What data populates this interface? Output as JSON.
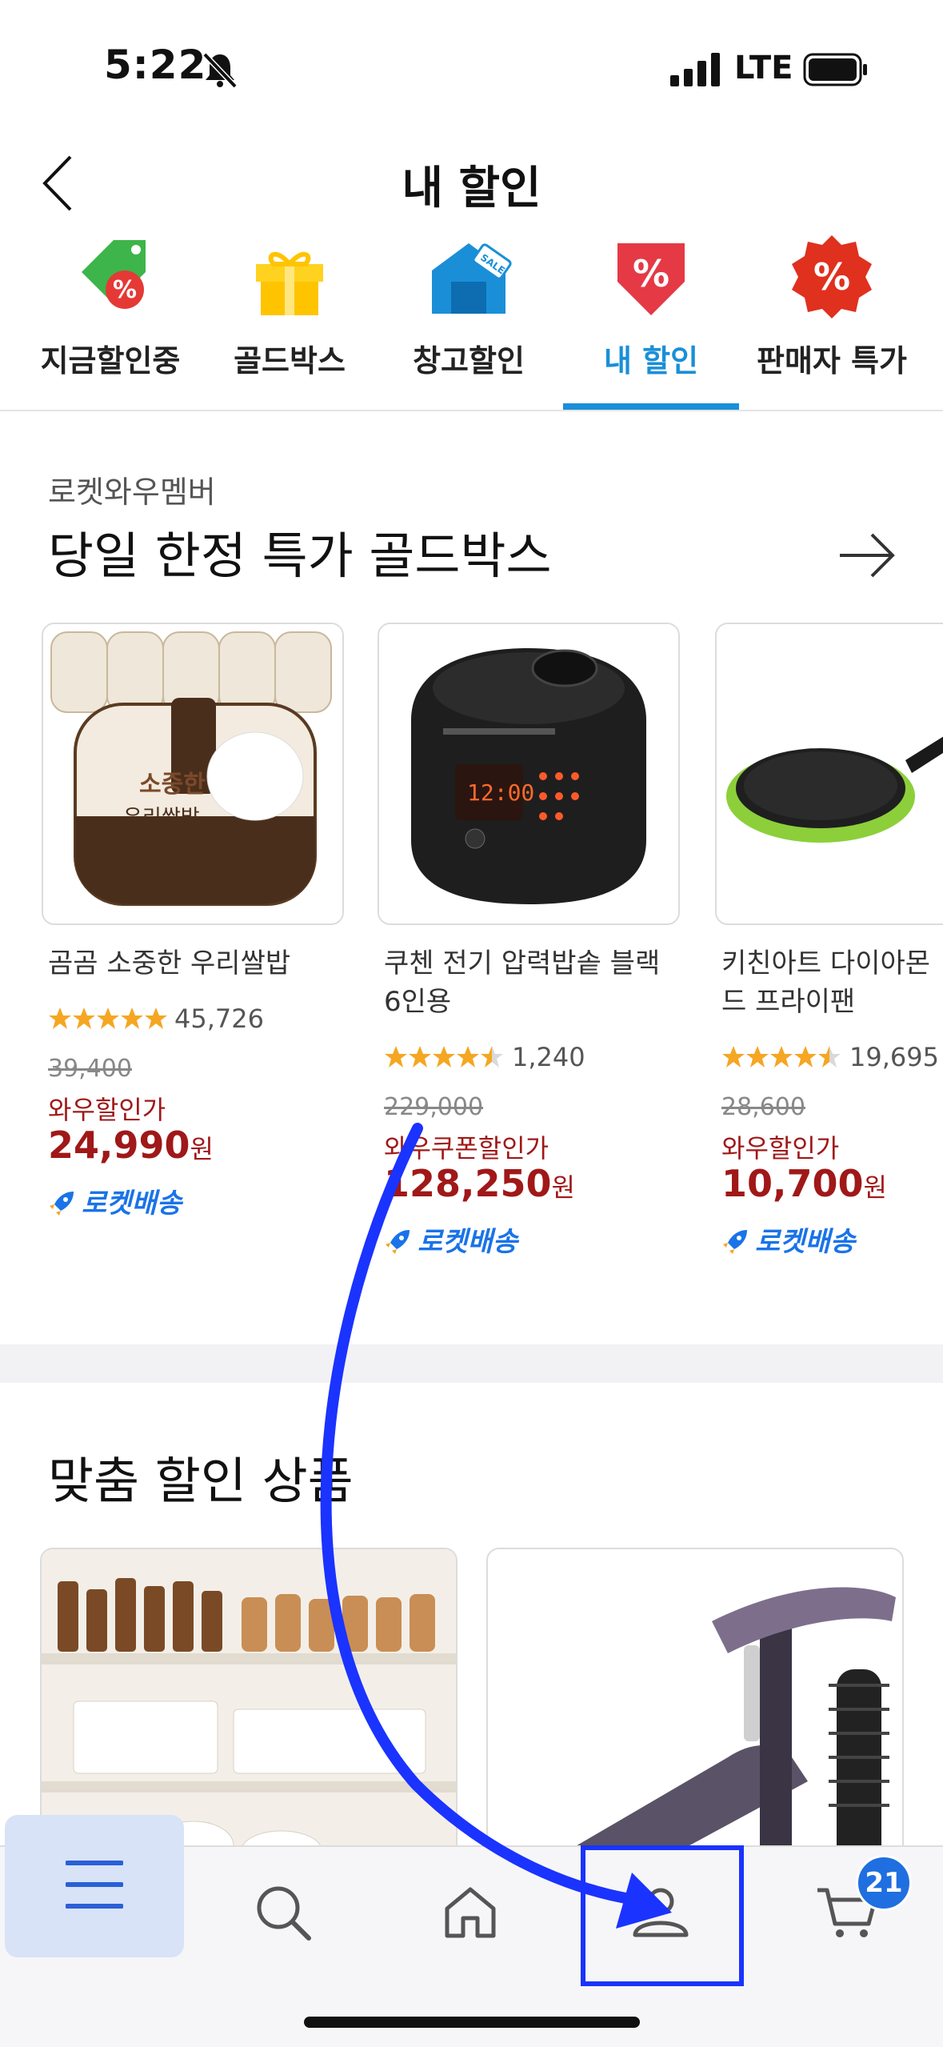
{
  "status_bar": {
    "time": "5:22",
    "network": "LTE"
  },
  "header": {
    "title": "내 할인"
  },
  "categories": [
    {
      "label": "지금할인중"
    },
    {
      "label": "골드박스"
    },
    {
      "label": "창고할인"
    },
    {
      "label": "내 할인",
      "active": true
    },
    {
      "label": "판매자 특가"
    }
  ],
  "gold_section": {
    "subtitle": "로켓와우멤버",
    "title": "당일 한정 특가 골드박스"
  },
  "products": [
    {
      "name": "곰곰 소중한 우리쌀밥",
      "rating": 5,
      "reviews": "45,726",
      "original_price": "39,400",
      "discount_label": "와우할인가",
      "price": "24,990",
      "currency": "원",
      "delivery": "로켓배송"
    },
    {
      "name": "쿠첸 전기 압력밥솥 블랙 6인용",
      "rating": 4.5,
      "reviews": "1,240",
      "original_price": "229,000",
      "discount_label": "와우쿠폰할인가",
      "price": "128,250",
      "currency": "원",
      "delivery": "로켓배송"
    },
    {
      "name": "키친아트 다이아몬드 프라이팬",
      "rating": 4.5,
      "reviews": "19,695",
      "original_price": "28,600",
      "discount_label": "와우할인가",
      "price": "10,700",
      "currency": "원",
      "delivery": "로켓배송"
    }
  ],
  "custom_section": {
    "title": "맞춤 할인 상품"
  },
  "bottom_nav": {
    "items": [
      "menu-icon",
      "search-icon",
      "home-icon",
      "profile-icon",
      "cart-icon"
    ],
    "cart_badge": "21"
  },
  "colors": {
    "accent": "#1a8fd8",
    "price": "#a01818",
    "annotation": "#1a33ff"
  }
}
